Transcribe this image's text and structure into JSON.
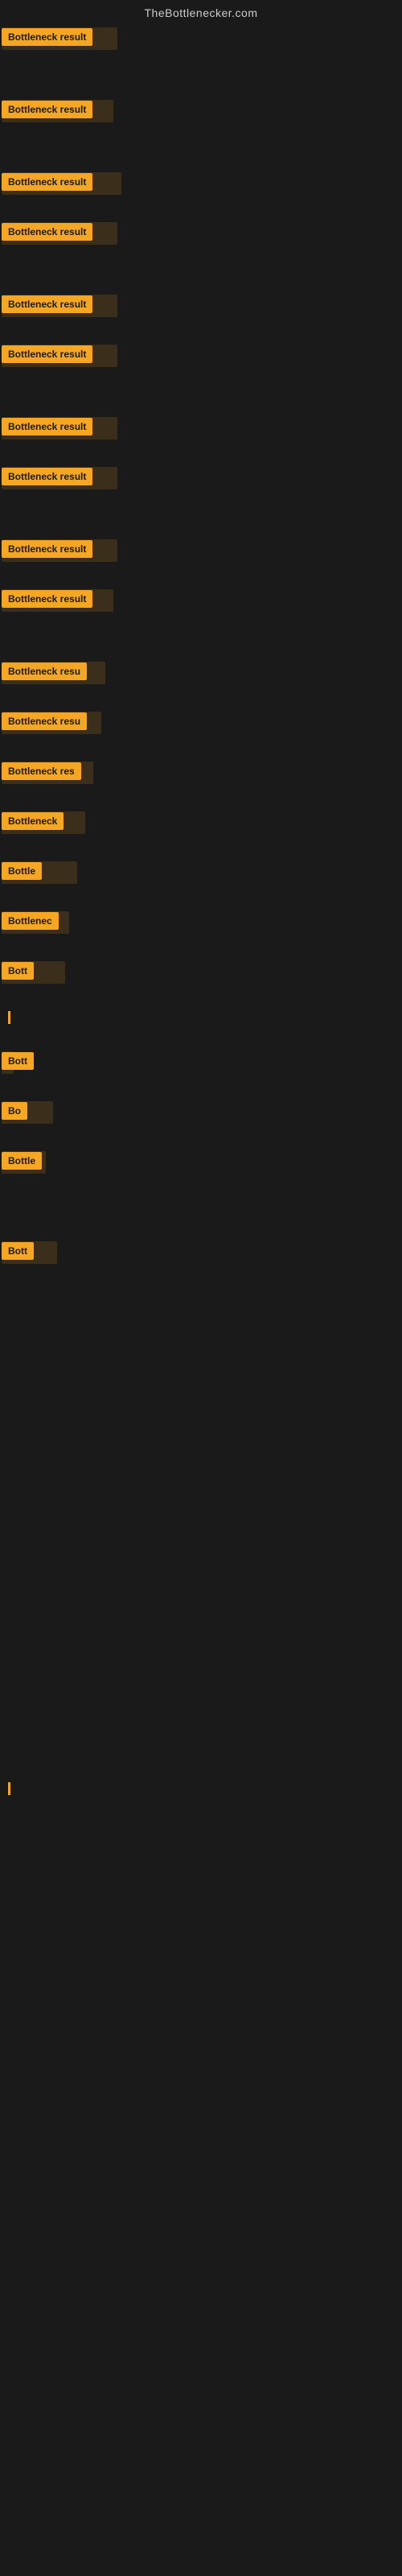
{
  "site": {
    "title": "TheBottlenecker.com"
  },
  "colors": {
    "badge_bg": "#f5a623",
    "page_bg": "#1a1a1a",
    "text_dark": "#1a1a1a"
  },
  "results": [
    {
      "id": 1,
      "label": "Bottleneck result",
      "gap_after": "lg"
    },
    {
      "id": 2,
      "label": "Bottleneck result",
      "gap_after": "lg"
    },
    {
      "id": 3,
      "label": "Bottleneck result",
      "gap_after": "sm"
    },
    {
      "id": 4,
      "label": "Bottleneck result",
      "gap_after": "lg"
    },
    {
      "id": 5,
      "label": "Bottleneck result",
      "gap_after": "sm"
    },
    {
      "id": 6,
      "label": "Bottleneck result",
      "gap_after": "lg"
    },
    {
      "id": 7,
      "label": "Bottleneck result",
      "gap_after": "sm"
    },
    {
      "id": 8,
      "label": "Bottleneck result",
      "gap_after": "lg"
    },
    {
      "id": 9,
      "label": "Bottleneck result",
      "gap_after": "sm"
    },
    {
      "id": 10,
      "label": "Bottleneck result",
      "gap_after": "lg"
    },
    {
      "id": 11,
      "label": "Bottleneck resu",
      "gap_after": "sm"
    },
    {
      "id": 12,
      "label": "Bottleneck resu",
      "gap_after": "sm"
    },
    {
      "id": 13,
      "label": "Bottleneck res",
      "gap_after": "sm"
    },
    {
      "id": 14,
      "label": "Bottleneck",
      "gap_after": "sm"
    },
    {
      "id": 15,
      "label": "Bottle",
      "gap_after": "sm"
    },
    {
      "id": 16,
      "label": "Bottlenec",
      "gap_after": "sm"
    },
    {
      "id": 17,
      "label": "Bott",
      "gap_after": "sm"
    },
    {
      "id": 18,
      "label": "|",
      "gap_after": "sm",
      "is_line": true
    },
    {
      "id": 19,
      "label": "Bott",
      "gap_after": "sm"
    },
    {
      "id": 20,
      "label": "Bo",
      "gap_after": "sm"
    },
    {
      "id": 21,
      "label": "Bottle",
      "gap_after": "lg"
    },
    {
      "id": 22,
      "label": "Bott",
      "gap_after": "xl"
    },
    {
      "id": 23,
      "label": "|",
      "gap_after": "xl",
      "is_line": true
    }
  ]
}
